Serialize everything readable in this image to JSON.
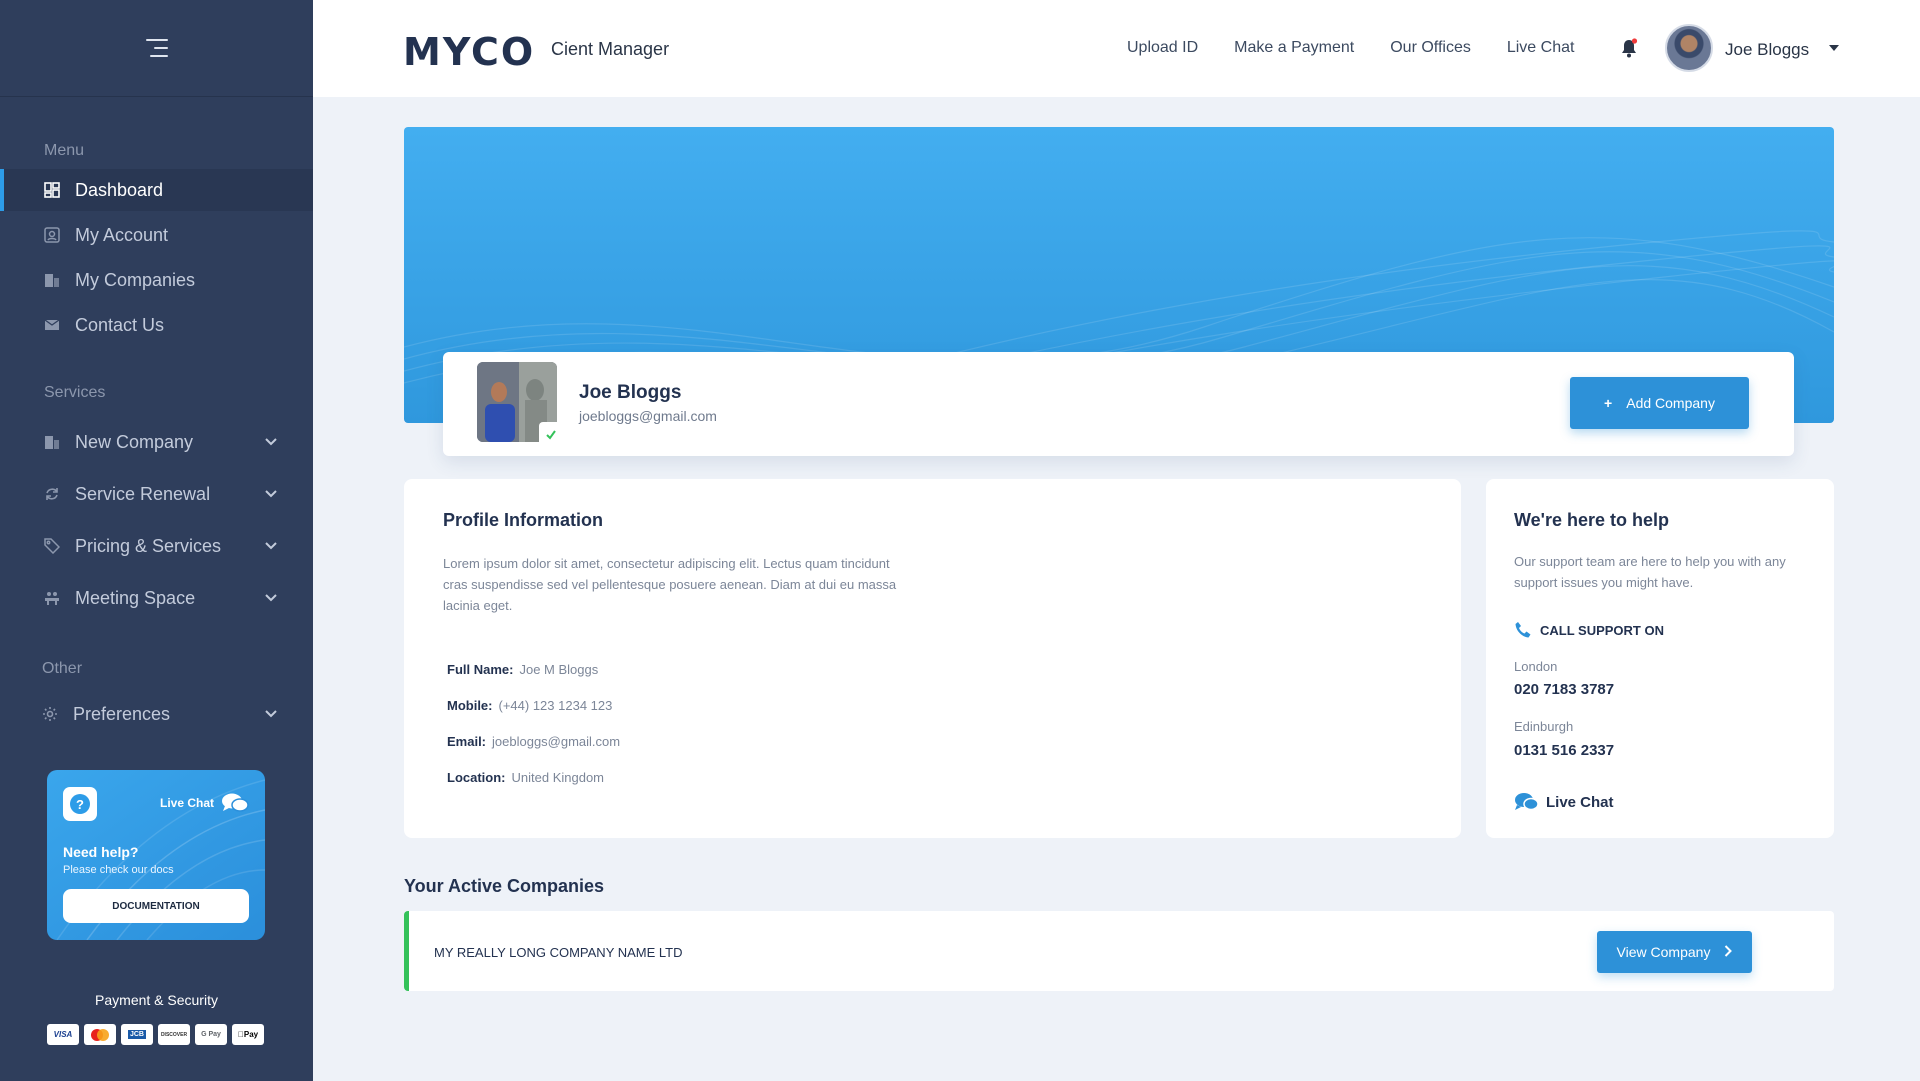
{
  "brand": {
    "logo_text": "MYCO",
    "app_name": "Cient Manager",
    "accent": "#2d9ce8",
    "sidebar_bg": "#2f3e5c"
  },
  "header": {
    "links": [
      "Upload ID",
      "Make a Payment",
      "Our Offices",
      "Live Chat"
    ],
    "user_name": "Joe Bloggs",
    "notification_icon": "bell-icon"
  },
  "sidebar": {
    "menu_title": "Menu",
    "menu_items": [
      {
        "label": "Dashboard",
        "icon": "dashboard-icon",
        "active": true
      },
      {
        "label": "My Account",
        "icon": "account-icon"
      },
      {
        "label": "My Companies",
        "icon": "building-icon"
      },
      {
        "label": "Contact Us",
        "icon": "mail-icon"
      }
    ],
    "services_title": "Services",
    "services_items": [
      {
        "label": "New Company",
        "icon": "building-icon"
      },
      {
        "label": "Service Renewal",
        "icon": "refresh-icon"
      },
      {
        "label": "Pricing & Services",
        "icon": "tag-icon"
      },
      {
        "label": "Meeting Space",
        "icon": "meeting-icon"
      }
    ],
    "other_title": "Other",
    "other_items": [
      {
        "label": "Preferences",
        "icon": "gear-icon"
      }
    ],
    "help_card": {
      "chat_label": "Live Chat",
      "title": "Need help?",
      "subtitle": "Please check our docs",
      "button": "DOCUMENTATION"
    },
    "payment_title": "Payment & Security",
    "payment_methods": [
      "VISA",
      "Mastercard",
      "JCB",
      "DISCOVER",
      "G Pay",
      "Apple Pay"
    ]
  },
  "profile": {
    "name": "Joe Bloggs",
    "email": "joebloggs@gmail.com",
    "add_company": "Add Company"
  },
  "profile_info": {
    "title": "Profile Information",
    "description": "Lorem ipsum dolor sit amet, consectetur adipiscing elit. Lectus quam tincidunt cras suspendisse sed vel pellentesque posuere aenean. Diam at dui eu massa lacinia eget.",
    "fields": [
      {
        "label": "Full Name:",
        "value": "Joe M Bloggs"
      },
      {
        "label": "Mobile:",
        "value": "(+44) 123 1234 123"
      },
      {
        "label": "Email:",
        "value": "joebloggs@gmail.com"
      },
      {
        "label": "Location:",
        "value": "United Kingdom"
      }
    ]
  },
  "help": {
    "title": "We're here to help",
    "description": "Our support team are here to help you with any support issues you might have.",
    "call_label": "CALL SUPPORT ON",
    "offices": [
      {
        "city": "London",
        "phone": "020 7183 3787"
      },
      {
        "city": "Edinburgh",
        "phone": "0131 516 2337"
      }
    ],
    "chat_label": "Live Chat"
  },
  "companies": {
    "title": "Your Active Companies",
    "items": [
      {
        "name": "MY REALLY LONG COMPANY NAME LTD",
        "button": "View Company"
      }
    ]
  }
}
